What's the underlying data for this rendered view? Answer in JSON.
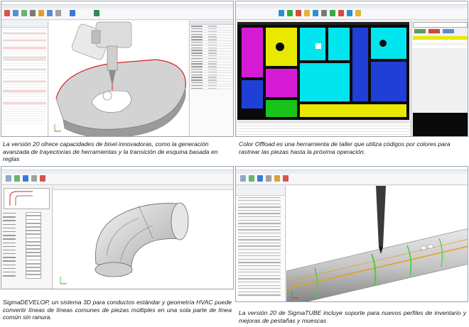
{
  "panels": [
    {
      "id": "bevel",
      "caption": "La versión 20 ofrece capacidades de bisel innovadoras, como la generación avanzada de trayectorias de herramientas y la transición de esquina basada en reglas"
    },
    {
      "id": "offload",
      "caption": "Color Offload es una herramienta de taller que utiliza códigos por colores para rastrear las piezas hasta la próxima operación."
    },
    {
      "id": "develop",
      "caption": "SigmaDEVELOP, un sistema 3D para conductos estándar y geometría HVAC puede convertir líneas de líneas comunes de piezas múltiples en una sola parte de línea común sin ranura."
    },
    {
      "id": "tube",
      "caption": "La versión 20 de SigmaTUBE incluye soporte para nuevos perfiles de inventario y mejoras de pestañas y muescas"
    }
  ],
  "colors": {
    "app_accent": "#2b6cb0",
    "cad_background": "#0a0a0a",
    "part_cyan": "#00e5ee",
    "part_magenta": "#d61bd6",
    "part_yellow": "#e8e800",
    "part_blue": "#1f3fd6",
    "part_green": "#18c418",
    "bevel_edge": "#e02020",
    "tube_orange": "#e6a020",
    "tab_green": "#40d040"
  }
}
